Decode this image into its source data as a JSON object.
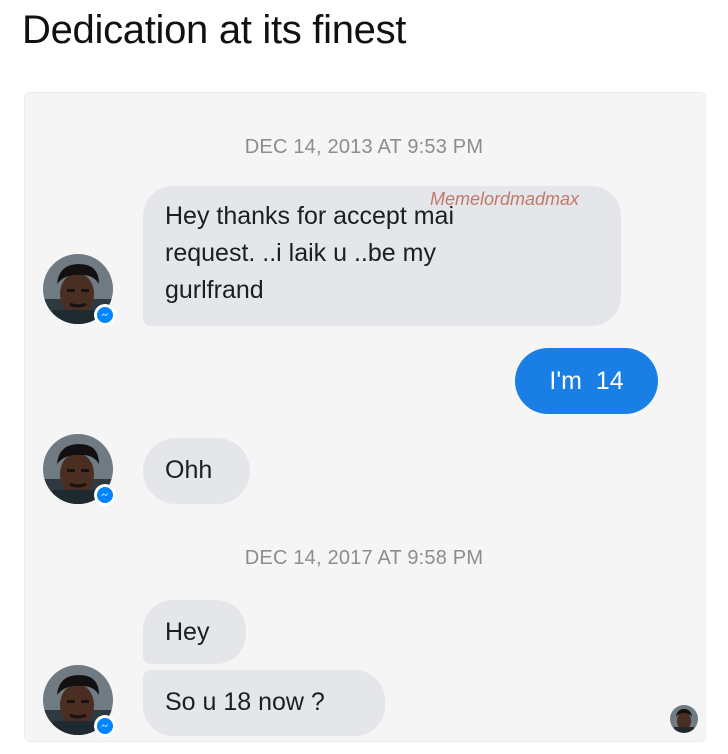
{
  "title": "Dedication at its finest",
  "watermark": "Memelordmadmax",
  "conversation": {
    "timestamp_1": "DEC 14, 2013 AT 9:53 PM",
    "timestamp_2": "DEC 14, 2017 AT 9:58 PM",
    "messages": [
      {
        "sender": "other",
        "lines": [
          "Hey thanks for accept mai",
          "request. ..i laik u ..be my",
          "gurlfrand"
        ]
      },
      {
        "sender": "me",
        "text": "I'm  14"
      },
      {
        "sender": "other",
        "text": "Ohh"
      },
      {
        "sender": "other",
        "text": "Hey"
      },
      {
        "sender": "other",
        "text": "So u 18 now ?"
      }
    ]
  },
  "icons": {
    "avatar": "profile-photo",
    "badge": "messenger-icon",
    "seen": "seen-indicator-avatar"
  },
  "colors": {
    "outgoing_bubble": "#1a7fe5",
    "incoming_bubble": "#e4e6ea",
    "timestamp": "#8a8d91",
    "messenger_badge": "#0084ff"
  }
}
